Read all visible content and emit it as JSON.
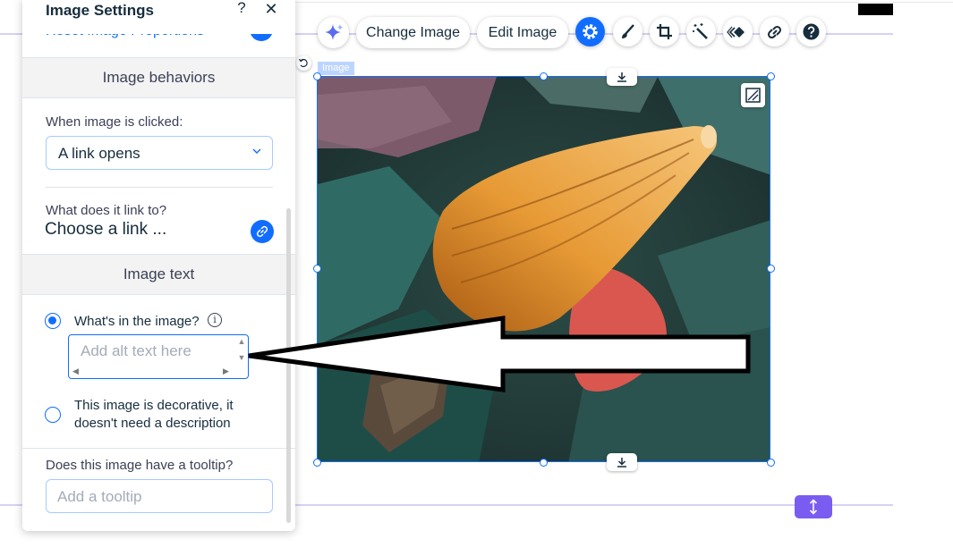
{
  "panel": {
    "title": "Image Settings",
    "help_label": "?",
    "close_label": "✕",
    "reset_link": "Reset Image Proportions",
    "behaviors_heading": "Image behaviors",
    "click_label": "When image is clicked:",
    "click_value": "A link opens",
    "link_label": "What does it link to?",
    "link_value": "Choose a link ...",
    "text_heading": "Image text",
    "alt_radio_label": "What's in the image?",
    "alt_placeholder": "Add alt text here",
    "decorative_label": "This image is decorative, it doesn't need a description",
    "tooltip_label": "Does this image have a tooltip?",
    "tooltip_placeholder": "Add a tooltip"
  },
  "toolbar": {
    "change_image": "Change Image",
    "edit_image": "Edit Image",
    "icons": [
      "ai-sparkle-icon",
      "settings-gear-icon",
      "brush-icon",
      "crop-icon",
      "magic-wand-icon",
      "animation-icon",
      "link-icon",
      "help-icon"
    ]
  },
  "canvas": {
    "element_tag": "Image"
  },
  "colors": {
    "accent": "#116dff",
    "guide": "#d6d1f5",
    "stretch": "#7a5cf0"
  }
}
